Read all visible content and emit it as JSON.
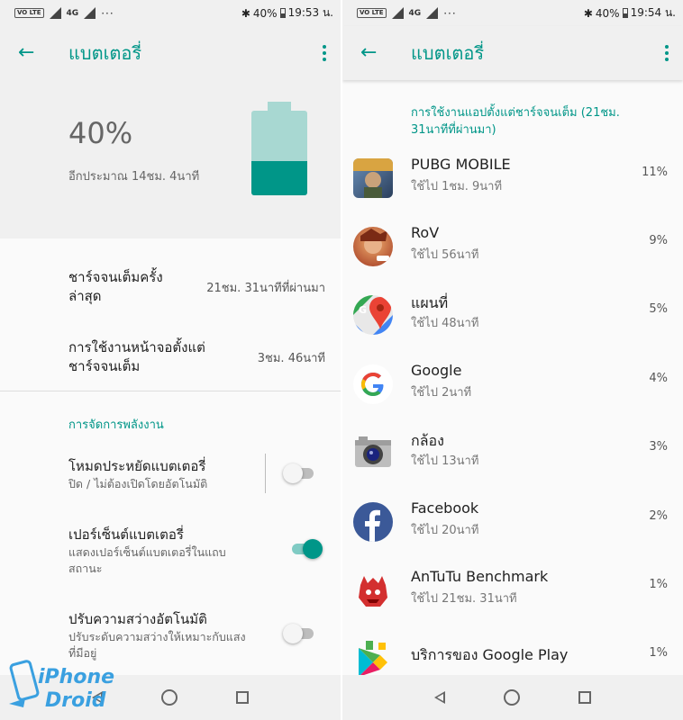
{
  "left": {
    "status": {
      "time": "19:53 น.",
      "battery_pct": "40%",
      "net": "4G",
      "volte": "VO LTE",
      "more": "···"
    },
    "appbar": {
      "title": "แบตเตอรี่"
    },
    "header": {
      "percent": "40%",
      "remaining": "อีกประมาณ 14ชม. 4นาที",
      "level": 0.4
    },
    "info": [
      {
        "label": "ชาร์จจนเต็มครั้ง\nล่าสุด",
        "value": "21ชม. 31นาทีที่ผ่านมา"
      },
      {
        "label": "การใช้งานหน้าจอตั้งแต่\nชาร์จจนเต็ม",
        "value": "3ชม. 46นาที"
      }
    ],
    "section": "การจัดการพลังงาน",
    "settings": [
      {
        "title": "โหมดประหยัดแบตเตอรี่",
        "subtitle": "ปิด / ไม่ต้องเปิดโดยอัตโนมัติ",
        "on": false
      },
      {
        "title": "เปอร์เซ็นต์แบตเตอรี่",
        "subtitle": "แสดงเปอร์เซ็นต์แบตเตอรี่ในแถบ\nสถานะ",
        "on": true
      },
      {
        "title": "ปรับความสว่างอัตโนมัติ",
        "subtitle": "ปรับระดับความสว่างให้เหมาะกับแสง\nที่มีอยู่",
        "on": false
      }
    ]
  },
  "right": {
    "status": {
      "time": "19:54 น.",
      "battery_pct": "40%",
      "net": "4G",
      "volte": "VO LTE",
      "more": "···"
    },
    "appbar": {
      "title": "แบตเตอรี่"
    },
    "usage_header": "การใช้งานแอปตั้งแต่ชาร์จจนเต็ม (21ชม.\n31นาทีที่ผ่านมา)",
    "apps": [
      {
        "name": "PUBG MOBILE",
        "time": "ใช้ไป 1ชม. 9นาที",
        "percent": "11%",
        "icon": "pubg-icon",
        "color": "#3b5f8a"
      },
      {
        "name": "RoV",
        "time": "ใช้ไป 56นาที",
        "percent": "9%",
        "icon": "rov-icon",
        "color": "#b5472a"
      },
      {
        "name": "แผนที่",
        "time": "ใช้ไป 48นาที",
        "percent": "5%",
        "icon": "maps-icon",
        "color": "#34a853"
      },
      {
        "name": "Google",
        "time": "ใช้ไป 2นาที",
        "percent": "4%",
        "icon": "google-icon",
        "color": "#ffffff"
      },
      {
        "name": "กล้อง",
        "time": "ใช้ไป 13นาที",
        "percent": "3%",
        "icon": "camera-icon",
        "color": "#9e9e9e"
      },
      {
        "name": "Facebook",
        "time": "ใช้ไป 20นาที",
        "percent": "2%",
        "icon": "facebook-icon",
        "color": "#3b5998"
      },
      {
        "name": "AnTuTu Benchmark",
        "time": "ใช้ไป 21ชม. 31นาที",
        "percent": "1%",
        "icon": "antutu-icon",
        "color": "#d32f2f"
      },
      {
        "name": "บริการของ Google Play",
        "time": "",
        "percent": "1%",
        "icon": "play-services-icon",
        "color": "#4caf50"
      }
    ]
  },
  "watermark": {
    "line1": "iPhone",
    "line2": "Droid"
  },
  "colors": {
    "accent": "#009688",
    "accent_light": "#80cbc4",
    "header_bg": "#f0f0f0"
  }
}
